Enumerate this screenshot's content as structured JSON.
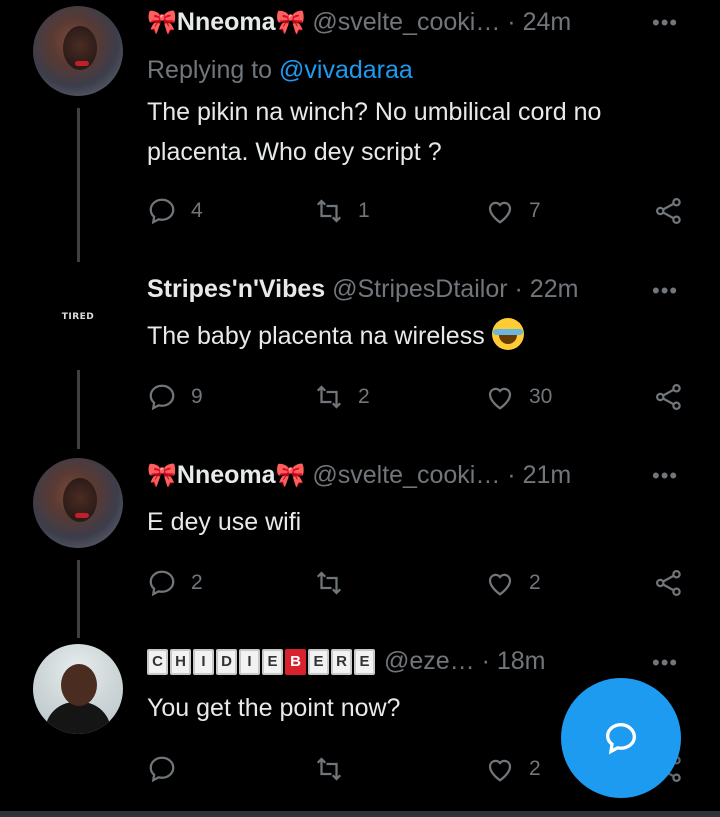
{
  "tweets": [
    {
      "name": "Nneoma",
      "bow": "🎀",
      "handle": "@svelte_cooki…",
      "time": "24m",
      "dot": "·",
      "replying_prefix": "Replying to",
      "replying_handle": "@vivadaraa",
      "text": "The pikin na winch? No umbilical cord no placenta. Who dey script ?",
      "replies": "4",
      "retweets": "1",
      "likes": "7"
    },
    {
      "name": "Stripes'n'Vibes",
      "handle": "@StripesDtailor",
      "time": "22m",
      "dot": "·",
      "avatar_text": "TIRED",
      "text": "The baby placenta na wireless",
      "emoji": "face-with-tears-of-joy",
      "replies": "9",
      "retweets": "2",
      "likes": "30"
    },
    {
      "name": "Nneoma",
      "bow": "🎀",
      "handle": "@svelte_cooki…",
      "time": "21m",
      "dot": "·",
      "text": "E dey use wifi",
      "replies": "2",
      "retweets": "",
      "likes": "2"
    },
    {
      "name_letters": [
        "C",
        "H",
        "I",
        "D",
        "I",
        "E",
        "B",
        "E",
        "R",
        "E"
      ],
      "handle": "@eze…",
      "time": "18m",
      "dot": "·",
      "text": "You get the point now?",
      "replies": "",
      "retweets": "",
      "likes": "2"
    }
  ],
  "more_icon": "more-horizontal-icon",
  "fab_icon": "compose-message-icon",
  "colors": {
    "accent": "#1d9bf0",
    "muted": "#71767b",
    "text": "#e7e9ea",
    "background": "#000000"
  }
}
